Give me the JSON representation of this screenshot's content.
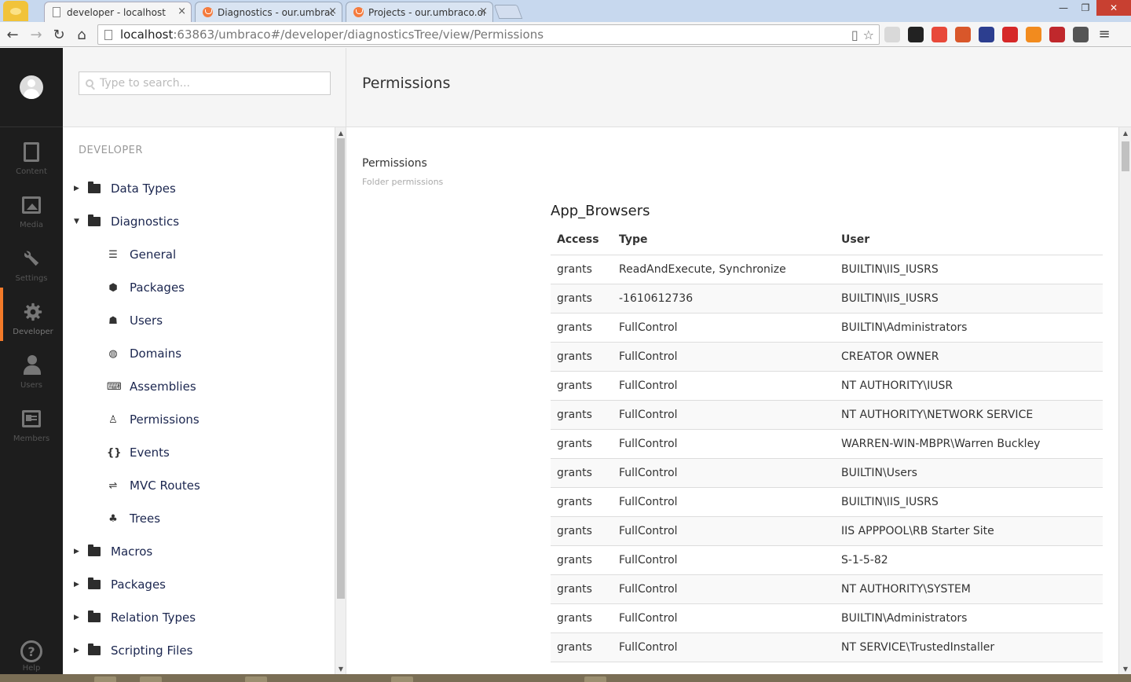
{
  "browser": {
    "tabs": [
      {
        "label": "developer - localhost",
        "active": true
      },
      {
        "label": "Diagnostics - our.umbrac",
        "active": false
      },
      {
        "label": "Projects - our.umbraco.or",
        "active": false
      }
    ],
    "close_glyph": "×",
    "url_host": "localhost",
    "url_rest": ":63863/umbraco#/developer/diagnosticsTree/view/Permissions",
    "controls": {
      "minimize": "—",
      "maximize": "❐",
      "close": "✕"
    },
    "nav": {
      "back": "←",
      "forward": "→",
      "reload": "↻",
      "home": "⌂"
    },
    "extension_colors": [
      "#d9d9d9",
      "#222222",
      "#e8493a",
      "#d9572a",
      "#2c3e8f",
      "#d62828",
      "#f28b1e",
      "#c0282c",
      "#555555"
    ],
    "menu_glyph": "≡"
  },
  "appbar": {
    "sections": [
      {
        "label": "Content",
        "icon": "document-icon",
        "active": false
      },
      {
        "label": "Media",
        "icon": "image-icon",
        "active": false
      },
      {
        "label": "Settings",
        "icon": "wrench-icon",
        "active": false
      },
      {
        "label": "Developer",
        "icon": "gear-icon",
        "active": true
      },
      {
        "label": "Users",
        "icon": "user-icon",
        "active": false
      },
      {
        "label": "Members",
        "icon": "id-card-icon",
        "active": false
      }
    ],
    "help": {
      "label": "Help",
      "glyph": "?"
    },
    "accent_color": "#f37a29"
  },
  "tree": {
    "search_placeholder": "Type to search...",
    "title": "DEVELOPER",
    "items": [
      {
        "label": "Data Types",
        "level": 0,
        "expanded": false
      },
      {
        "label": "Diagnostics",
        "level": 0,
        "expanded": true
      },
      {
        "label": "General",
        "level": 1,
        "icon": "server-icon",
        "glyph": "☰"
      },
      {
        "label": "Packages",
        "level": 1,
        "icon": "box-icon",
        "glyph": "⬢"
      },
      {
        "label": "Users",
        "level": 1,
        "icon": "users-icon",
        "glyph": "☗"
      },
      {
        "label": "Domains",
        "level": 1,
        "icon": "globe-icon",
        "glyph": "◍"
      },
      {
        "label": "Assemblies",
        "level": 1,
        "icon": "keyboard-icon",
        "glyph": "⌨"
      },
      {
        "label": "Permissions",
        "level": 1,
        "icon": "person-icon",
        "glyph": "♙"
      },
      {
        "label": "Events",
        "level": 1,
        "icon": "braces-icon",
        "glyph": "{}"
      },
      {
        "label": "MVC Routes",
        "level": 1,
        "icon": "signpost-icon",
        "glyph": "⇌"
      },
      {
        "label": "Trees",
        "level": 1,
        "icon": "tree-icon",
        "glyph": "♣"
      },
      {
        "label": "Macros",
        "level": 0,
        "expanded": false
      },
      {
        "label": "Packages",
        "level": 0,
        "expanded": false
      },
      {
        "label": "Relation Types",
        "level": 0,
        "expanded": false
      },
      {
        "label": "Scripting Files",
        "level": 0,
        "expanded": false
      }
    ]
  },
  "editor": {
    "title": "Permissions",
    "property_label": "Permissions",
    "property_description": "Folder permissions",
    "folder_name": "App_Browsers",
    "columns": [
      "Access",
      "Type",
      "User"
    ],
    "rows": [
      [
        "grants",
        "ReadAndExecute, Synchronize",
        "BUILTIN\\IIS_IUSRS"
      ],
      [
        "grants",
        "-1610612736",
        "BUILTIN\\IIS_IUSRS"
      ],
      [
        "grants",
        "FullControl",
        "BUILTIN\\Administrators"
      ],
      [
        "grants",
        "FullControl",
        "CREATOR OWNER"
      ],
      [
        "grants",
        "FullControl",
        "NT AUTHORITY\\IUSR"
      ],
      [
        "grants",
        "FullControl",
        "NT AUTHORITY\\NETWORK SERVICE"
      ],
      [
        "grants",
        "FullControl",
        "WARREN-WIN-MBPR\\Warren Buckley"
      ],
      [
        "grants",
        "FullControl",
        "BUILTIN\\Users"
      ],
      [
        "grants",
        "FullControl",
        "BUILTIN\\IIS_IUSRS"
      ],
      [
        "grants",
        "FullControl",
        "IIS APPPOOL\\RB Starter Site"
      ],
      [
        "grants",
        "FullControl",
        "S-1-5-82"
      ],
      [
        "grants",
        "FullControl",
        "NT AUTHORITY\\SYSTEM"
      ],
      [
        "grants",
        "FullControl",
        "BUILTIN\\Administrators"
      ],
      [
        "grants",
        "FullControl",
        "NT SERVICE\\TrustedInstaller"
      ]
    ]
  }
}
